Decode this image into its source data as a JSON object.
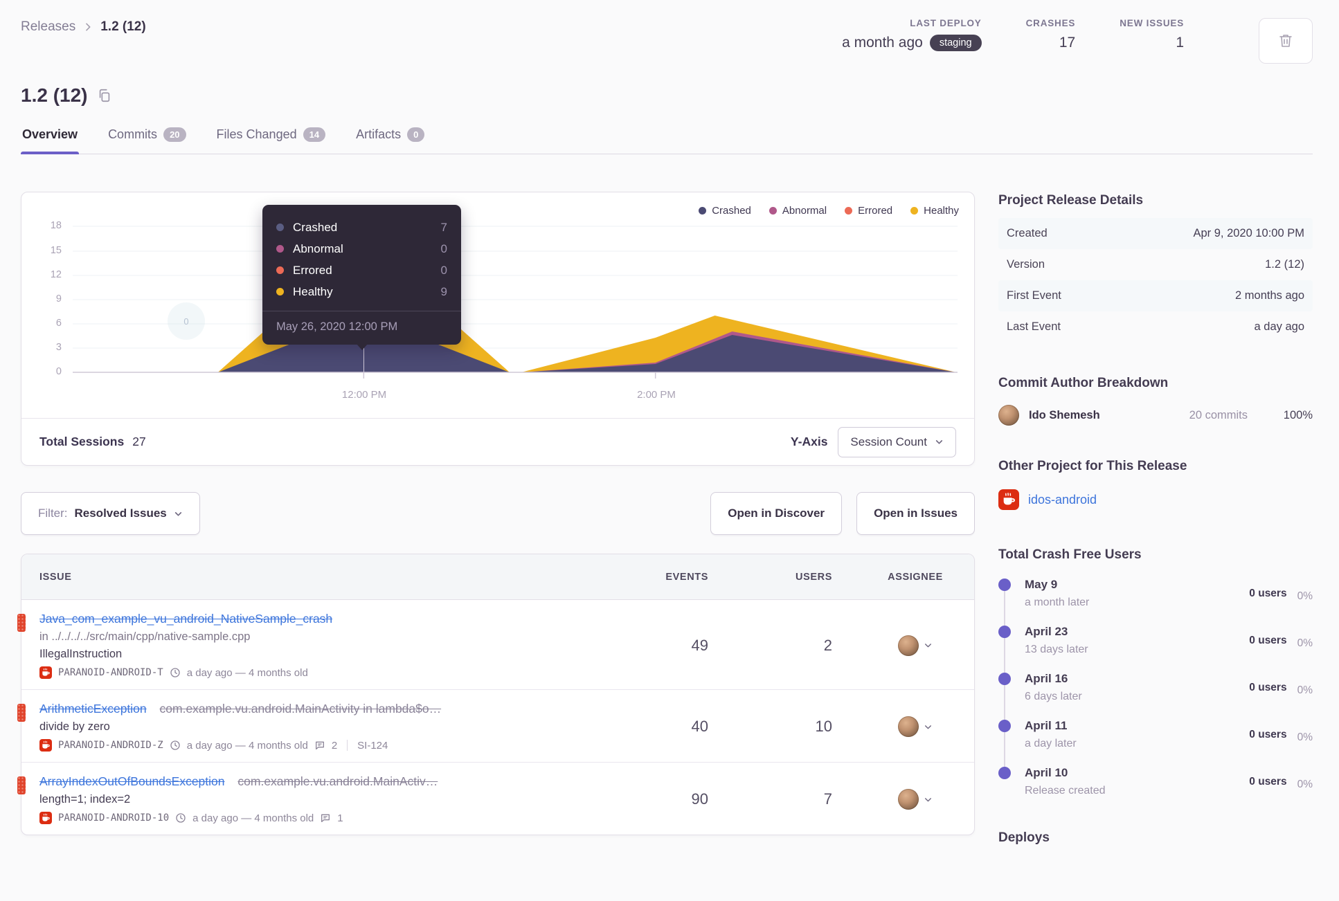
{
  "breadcrumb": {
    "parent": "Releases",
    "current": "1.2 (12)"
  },
  "header": {
    "last_deploy": {
      "label": "LAST DEPLOY",
      "value": "a month ago",
      "environment": "staging"
    },
    "crashes": {
      "label": "CRASHES",
      "value": "17"
    },
    "new_issues": {
      "label": "NEW ISSUES",
      "value": "1"
    }
  },
  "title": {
    "text": "1.2 (12)"
  },
  "tabs": [
    {
      "label": "Overview"
    },
    {
      "label": "Commits",
      "count": "20"
    },
    {
      "label": "Files Changed",
      "count": "14"
    },
    {
      "label": "Artifacts",
      "count": "0"
    }
  ],
  "chart": {
    "legend": [
      {
        "label": "Crashed",
        "color": "#4b4a73"
      },
      {
        "label": "Abnormal",
        "color": "#b0588a"
      },
      {
        "label": "Errored",
        "color": "#ec6a56"
      },
      {
        "label": "Healthy",
        "color": "#eeb320"
      }
    ],
    "y_ticks": [
      "18",
      "15",
      "12",
      "9",
      "6",
      "3",
      "0"
    ],
    "x_ticks": [
      "12:00 PM",
      "2:00 PM"
    ],
    "zero_marker": "0",
    "tooltip": {
      "rows": [
        {
          "label": "Crashed",
          "value": "7"
        },
        {
          "label": "Abnormal",
          "value": "0"
        },
        {
          "label": "Errored",
          "value": "0"
        },
        {
          "label": "Healthy",
          "value": "9"
        }
      ],
      "timestamp": "May 26, 2020 12:00 PM"
    },
    "footer": {
      "total_label": "Total Sessions",
      "total_value": "27",
      "y_axis_label": "Y-Axis",
      "y_axis_value": "Session Count"
    },
    "chart_data": {
      "type": "area",
      "stacked": true,
      "x": [
        "11:00 AM",
        "12:00 PM",
        "1:00 PM",
        "2:00 PM",
        "2:55 PM",
        "3:45 PM"
      ],
      "series": [
        {
          "name": "Crashed",
          "color": "#4b4a73",
          "values": [
            0,
            7,
            0,
            1,
            5,
            0
          ]
        },
        {
          "name": "Abnormal",
          "color": "#b0588a",
          "values": [
            0,
            0,
            0,
            0,
            0.4,
            0
          ]
        },
        {
          "name": "Errored",
          "color": "#ec6a56",
          "values": [
            0,
            0,
            0,
            0,
            0,
            0
          ]
        },
        {
          "name": "Healthy",
          "color": "#eeb320",
          "values": [
            0,
            9,
            0,
            3.3,
            1.6,
            0
          ]
        }
      ],
      "ylim": [
        0,
        18
      ],
      "yticks": [
        0,
        3,
        6,
        9,
        12,
        15,
        18
      ],
      "xlabel": "",
      "ylabel": "Session Count",
      "legend_position": "top-right",
      "grid": true,
      "total_sessions": 27
    }
  },
  "controls": {
    "filter_label": "Filter:",
    "filter_value": "Resolved Issues",
    "open_in_discover": "Open in Discover",
    "open_in_issues": "Open in Issues"
  },
  "issues": {
    "columns": {
      "issue": "ISSUE",
      "events": "EVENTS",
      "users": "USERS",
      "assignee": "ASSIGNEE"
    },
    "rows": [
      {
        "title": "Java_com_example_vu_android_NativeSample_crash",
        "location": "in ../../../../src/main/cpp/native-sample.cpp",
        "message": "IllegalInstruction",
        "project": "PARANOID-ANDROID-T",
        "age": "a day ago — 4 months old",
        "events": "49",
        "users": "2"
      },
      {
        "title": "ArithmeticException",
        "subtitle": "com.example.vu.android.MainActivity in lambda$o…",
        "message": "divide by zero",
        "project": "PARANOID-ANDROID-Z",
        "age": "a day ago — 4 months old",
        "comments": "2",
        "ticket": "SI-124",
        "events": "40",
        "users": "10"
      },
      {
        "title": "ArrayIndexOutOfBoundsException",
        "subtitle": "com.example.vu.android.MainActiv…",
        "message": "length=1; index=2",
        "project": "PARANOID-ANDROID-10",
        "age": "a day ago — 4 months old",
        "comments": "1",
        "events": "90",
        "users": "7"
      }
    ]
  },
  "sidebar": {
    "details": {
      "heading": "Project Release Details",
      "rows": [
        {
          "label": "Created",
          "value": "Apr 9, 2020 10:00 PM"
        },
        {
          "label": "Version",
          "value": "1.2 (12)"
        },
        {
          "label": "First Event",
          "value": "2 months ago"
        },
        {
          "label": "Last Event",
          "value": "a day ago"
        }
      ]
    },
    "authors": {
      "heading": "Commit Author Breakdown",
      "name": "Ido Shemesh",
      "commits": "20 commits",
      "percent": "100%"
    },
    "other_project": {
      "heading": "Other Project for This Release",
      "project": "idos-android"
    },
    "crash_free": {
      "heading": "Total Crash Free Users",
      "items": [
        {
          "date": "May 9",
          "sub": "a month later",
          "users": "0 users",
          "percent": "0%"
        },
        {
          "date": "April 23",
          "sub": "13 days later",
          "users": "0 users",
          "percent": "0%"
        },
        {
          "date": "April 16",
          "sub": "6 days later",
          "users": "0 users",
          "percent": "0%"
        },
        {
          "date": "April 11",
          "sub": "a day later",
          "users": "0 users",
          "percent": "0%"
        },
        {
          "date": "April 10",
          "sub": "Release created",
          "users": "0 users",
          "percent": "0%"
        }
      ]
    },
    "deploys": {
      "heading": "Deploys"
    }
  },
  "colors": {
    "accent": "#6c5fc7",
    "link": "#3d74db",
    "crashed": "#4b4a73",
    "abnormal": "#b0588a",
    "errored": "#ec6a56",
    "healthy": "#eeb320",
    "level_red": "#e0442c",
    "tooltip_bg": "#2e2837",
    "env_pill_bg": "#474153"
  }
}
